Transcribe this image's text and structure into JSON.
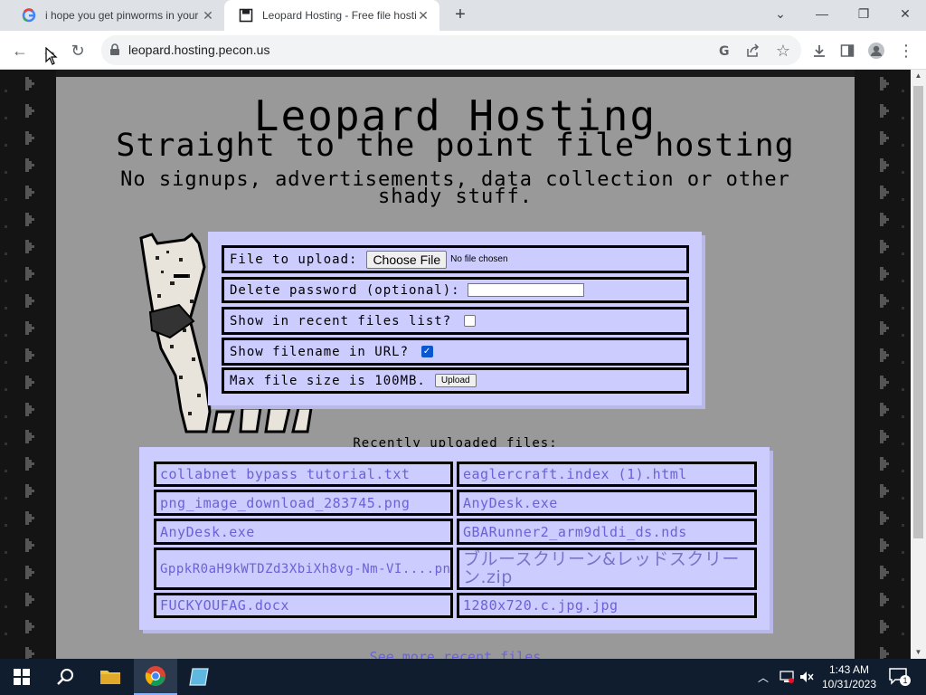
{
  "browser": {
    "tabs": [
      {
        "title": "i hope you get pinworms in your",
        "favicon": "google-icon",
        "active": false
      },
      {
        "title": "Leopard Hosting - Free file hosti",
        "favicon": "page-icon",
        "active": true
      }
    ],
    "url": "leopard.hosting.pecon.us"
  },
  "page": {
    "title": "Leopard Hosting",
    "subtitle": "Straight to the point file hosting",
    "description": "No signups, advertisements, data collection or other shady stuff.",
    "form": {
      "file_label": "File to upload:",
      "choose_file": "Choose File",
      "no_file": "No file chosen",
      "delete_label": "Delete password (optional):",
      "recent_label": "Show in recent files list?",
      "recent_checked": false,
      "filename_label": "Show filename in URL?",
      "filename_checked": true,
      "max_size": "Max file size is 100MB.",
      "upload": "Upload"
    },
    "recent_heading": "Recently uploaded files:",
    "recent_files": [
      "collabnet bypass tutorial.txt",
      "eaglercraft.index (1).html",
      "png_image_download_283745.png",
      "AnyDesk.exe",
      "AnyDesk.exe",
      "GBARunner2_arm9dldi_ds.nds",
      "GppkR0aH9kWTDZd3XbiXh8vg-Nm-VI....png",
      "ブルースクリーン&レッドスクリーン.zip",
      "FUCKYOUFAG.docx",
      "1280x720.c.jpg.jpg"
    ],
    "see_more": "See more recent files"
  },
  "taskbar": {
    "time": "1:43 AM",
    "date": "10/31/2023",
    "notification_count": "1"
  },
  "colors": {
    "panel": "#ccccff",
    "file_link": "#6a62d6",
    "page_bg": "#999999"
  }
}
